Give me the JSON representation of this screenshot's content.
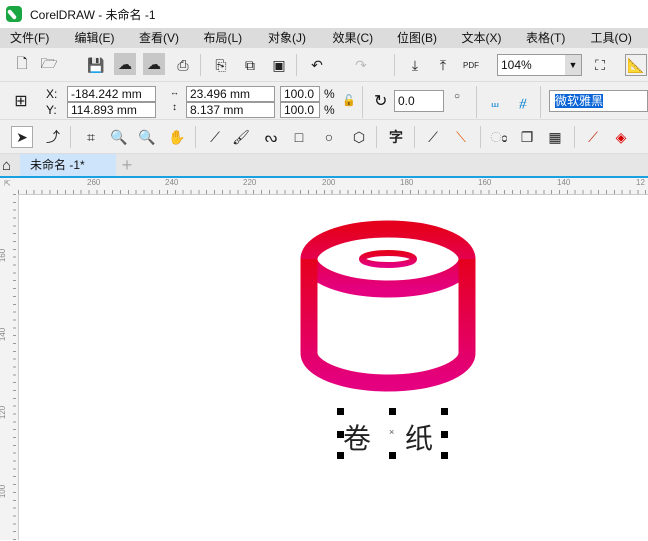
{
  "window": {
    "title": "CorelDRAW - 未命名 -1"
  },
  "menu": [
    "文件(F)",
    "编辑(E)",
    "查看(V)",
    "布局(L)",
    "对象(J)",
    "效果(C)",
    "位图(B)",
    "文本(X)",
    "表格(T)",
    "工具(O)"
  ],
  "toolbar": {
    "zoom": "104%",
    "pdf_label": "PDF"
  },
  "property_bar": {
    "x_label": "X:",
    "y_label": "Y:",
    "x": "-184.242 mm",
    "y": "114.893 mm",
    "width": "23.496 mm",
    "height": "8.137 mm",
    "scale_x": "100.0",
    "scale_y": "100.0",
    "percent": "%",
    "rotation": "0.0",
    "font": "微软雅黑"
  },
  "tools": {
    "text_tool": "字"
  },
  "tabs": {
    "document": "未命名 -1*",
    "add": "+"
  },
  "rulers": {
    "horizontal": [
      "260",
      "240",
      "220",
      "200",
      "180",
      "160",
      "140",
      "12"
    ],
    "vertical": [
      "160",
      "140",
      "120",
      "100"
    ]
  },
  "canvas": {
    "text_left": "卷",
    "text_right": "纸",
    "gradient": [
      "#e5001e",
      "#e4007f"
    ]
  },
  "colors": {
    "tab_accent": "#1ba1e2",
    "selection": "#0a64d6"
  }
}
